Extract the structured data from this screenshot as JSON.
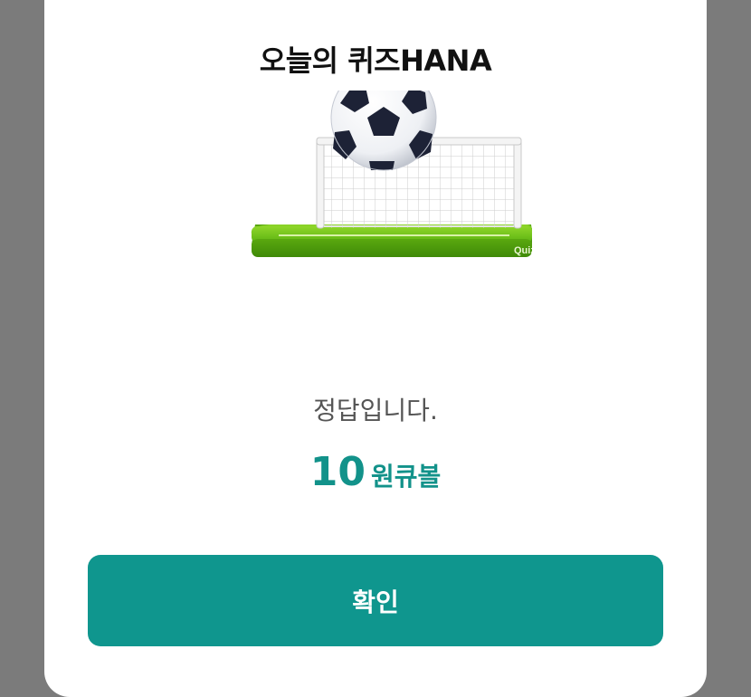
{
  "dialog": {
    "title": "오늘의 퀴즈HANA",
    "illustration": {
      "icon": "soccer-goal-icon",
      "label": "Quiz"
    },
    "message": "정답입니다.",
    "reward": {
      "amount": "10",
      "unit": "원큐볼"
    },
    "confirm_label": "확인"
  },
  "colors": {
    "accent": "#0f968e",
    "reward_text": "#12928a",
    "field_green": "#6cc41c",
    "backdrop": "#7b7b7b"
  }
}
